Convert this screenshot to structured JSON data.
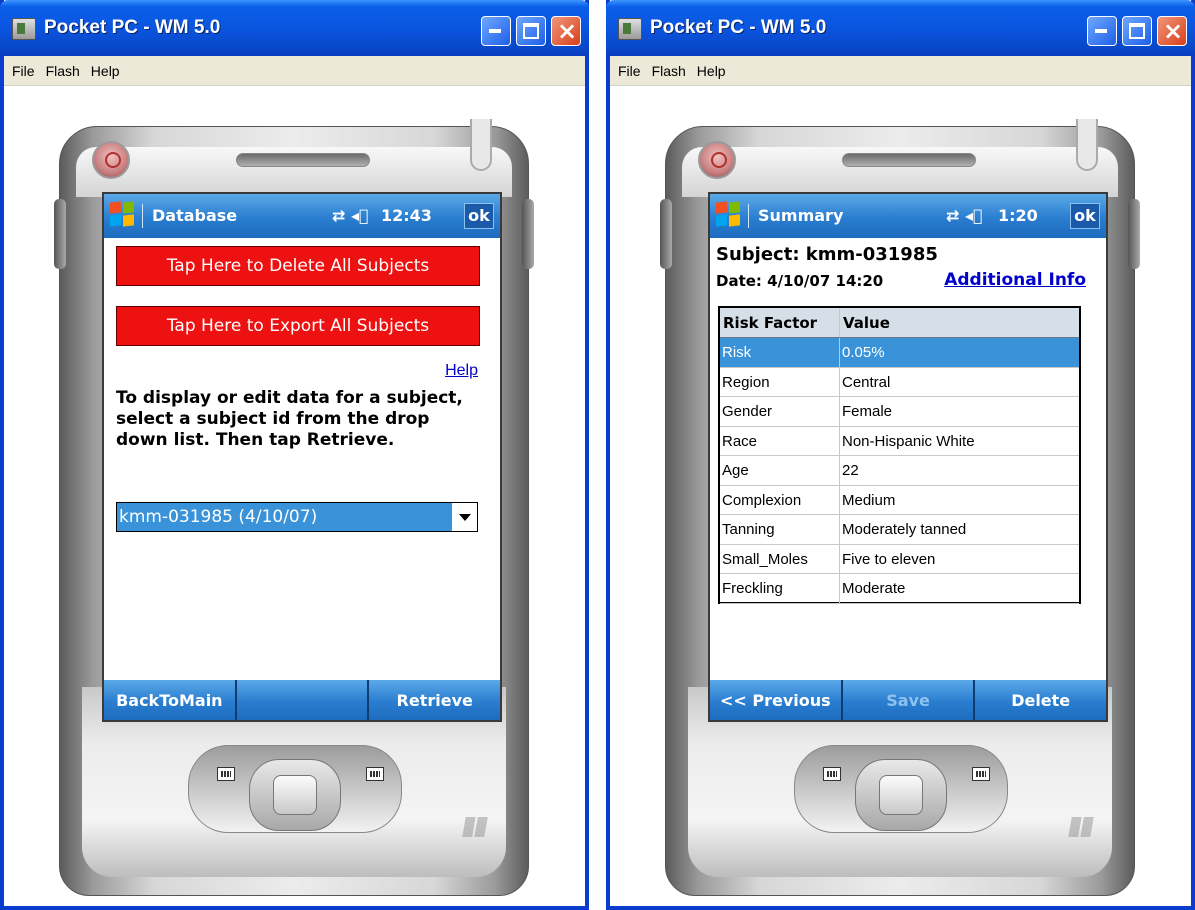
{
  "windows": [
    {
      "title": "Pocket PC - WM 5.0",
      "menu": [
        "File",
        "Flash",
        "Help"
      ],
      "screen": {
        "nav_title": "Database",
        "status": "12:43",
        "ok": "ok",
        "delete_button": "Tap Here to Delete All Subjects",
        "export_button": "Tap Here to Export All Subjects",
        "help_link": "Help",
        "instruction": "To display or edit data for a subject, select a subject id from the drop down list.  Then tap Retrieve.",
        "subject_dropdown": "kmm-031985 (4/10/07)",
        "softkeys": [
          "BackToMain",
          "",
          "Retrieve"
        ]
      }
    },
    {
      "title": "Pocket PC - WM 5.0",
      "menu": [
        "File",
        "Flash",
        "Help"
      ],
      "screen": {
        "nav_title": "Summary",
        "status": "1:20",
        "ok": "ok",
        "subject_line": "Subject: kmm-031985",
        "date_line": "Date: 4/10/07 14:20",
        "additional_info_link": "Additional Info",
        "table": {
          "headers": [
            "Risk Factor",
            "Value"
          ],
          "rows": [
            [
              "Risk",
              "0.05%"
            ],
            [
              "Region",
              "Central"
            ],
            [
              "Gender",
              "Female"
            ],
            [
              "Race",
              "Non-Hispanic White"
            ],
            [
              "Age",
              "22"
            ],
            [
              "Complexion",
              "Medium"
            ],
            [
              "Tanning",
              "Moderately tanned"
            ],
            [
              "Small_Moles",
              "Five to eleven"
            ],
            [
              "Freckling",
              "Moderate"
            ]
          ],
          "selected_row": 0
        },
        "softkeys": [
          "<< Previous",
          "Save",
          "Delete"
        ]
      }
    }
  ],
  "colors": {
    "title_bar": "#0a5fe8",
    "nav_bar": "#2a7dcf",
    "red_button": "#ee1111",
    "selection": "#3a93d8",
    "link": "#0000cc"
  }
}
